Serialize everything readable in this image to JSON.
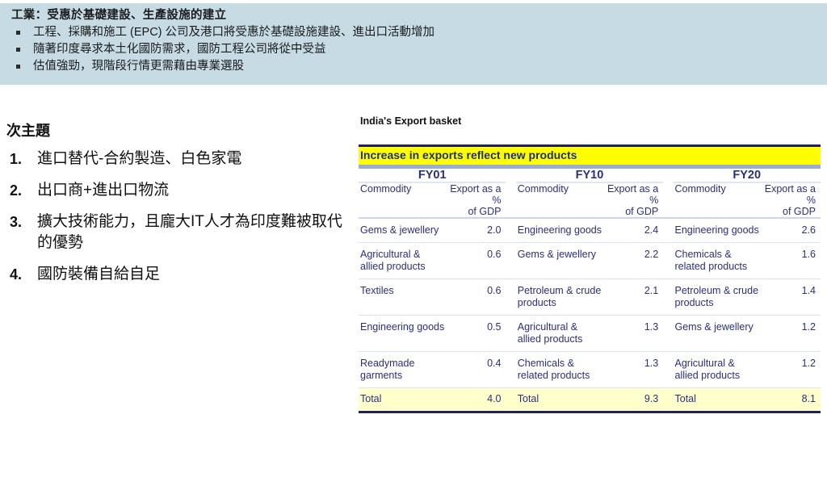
{
  "banner": {
    "title": "工業：受惠於基礎建設、生產設施的建立",
    "bullets": [
      "工程、採購和施工 (EPC) 公司及港口將受惠於基礎設施建設、進出口活動增加",
      "隨著印度尋求本土化國防需求，國防工程公司將從中受益",
      "估值強勁，現階段行情更需藉由專業選股"
    ],
    "bg_color": "#c6dbe3",
    "bullet_icon": "square-bullet-icon"
  },
  "left": {
    "heading": "次主題",
    "items": [
      {
        "num": "1.",
        "text": "進口替代-合約製造、白色家電"
      },
      {
        "num": "2.",
        "text": "出口商+進出口物流"
      },
      {
        "num": "3.",
        "text": "擴大技術能力，且龐大IT人才為印度難被取代的優勢"
      },
      {
        "num": "4.",
        "text": "國防裝備自給自足"
      }
    ]
  },
  "panel": {
    "title": "India's Export basket",
    "banner_label": "Increase in exports reflect new products",
    "banner_bg": "#ffff00",
    "banner_text_color": "#1f2f7a",
    "rule_color": "#1f2259",
    "total_row_bg": "#ffffcc"
  },
  "chart_data": {
    "type": "table",
    "title": "India's Export basket",
    "subtitle": "Increase in exports reflect new products",
    "groups": [
      "FY01",
      "FY10",
      "FY20"
    ],
    "columns": [
      "Commodity",
      "Export as a % of GDP"
    ],
    "column_headers": {
      "name": "Commodity",
      "value_line1": "Export as a %",
      "value_line2": "of GDP"
    },
    "rows": [
      {
        "fy01": {
          "commodity": "Gems & jewellery",
          "value": "2.0"
        },
        "fy10": {
          "commodity": "Engineering goods",
          "value": "2.4"
        },
        "fy20": {
          "commodity": "Engineering goods",
          "value": "2.6"
        }
      },
      {
        "fy01": {
          "commodity": "Agricultural & allied products",
          "value": "0.6"
        },
        "fy10": {
          "commodity": "Gems & jewellery",
          "value": "2.2"
        },
        "fy20": {
          "commodity": "Chemicals & related products",
          "value": "1.6"
        }
      },
      {
        "fy01": {
          "commodity": "Textiles",
          "value": "0.6"
        },
        "fy10": {
          "commodity": "Petroleum & crude products",
          "value": "2.1"
        },
        "fy20": {
          "commodity": "Petroleum & crude products",
          "value": "1.4"
        }
      },
      {
        "fy01": {
          "commodity": "Engineering goods",
          "value": "0.5"
        },
        "fy10": {
          "commodity": "Agricultural & allied products",
          "value": "1.3"
        },
        "fy20": {
          "commodity": "Gems & jewellery",
          "value": "1.2"
        }
      },
      {
        "fy01": {
          "commodity": "Readymade garments",
          "value": "0.4"
        },
        "fy10": {
          "commodity": "Chemicals & related products",
          "value": "1.3"
        },
        "fy20": {
          "commodity": "Agricultural & allied products",
          "value": "1.2"
        }
      }
    ],
    "total": {
      "label": "Total",
      "fy01": "4.0",
      "fy10": "9.3",
      "fy20": "8.1"
    }
  }
}
